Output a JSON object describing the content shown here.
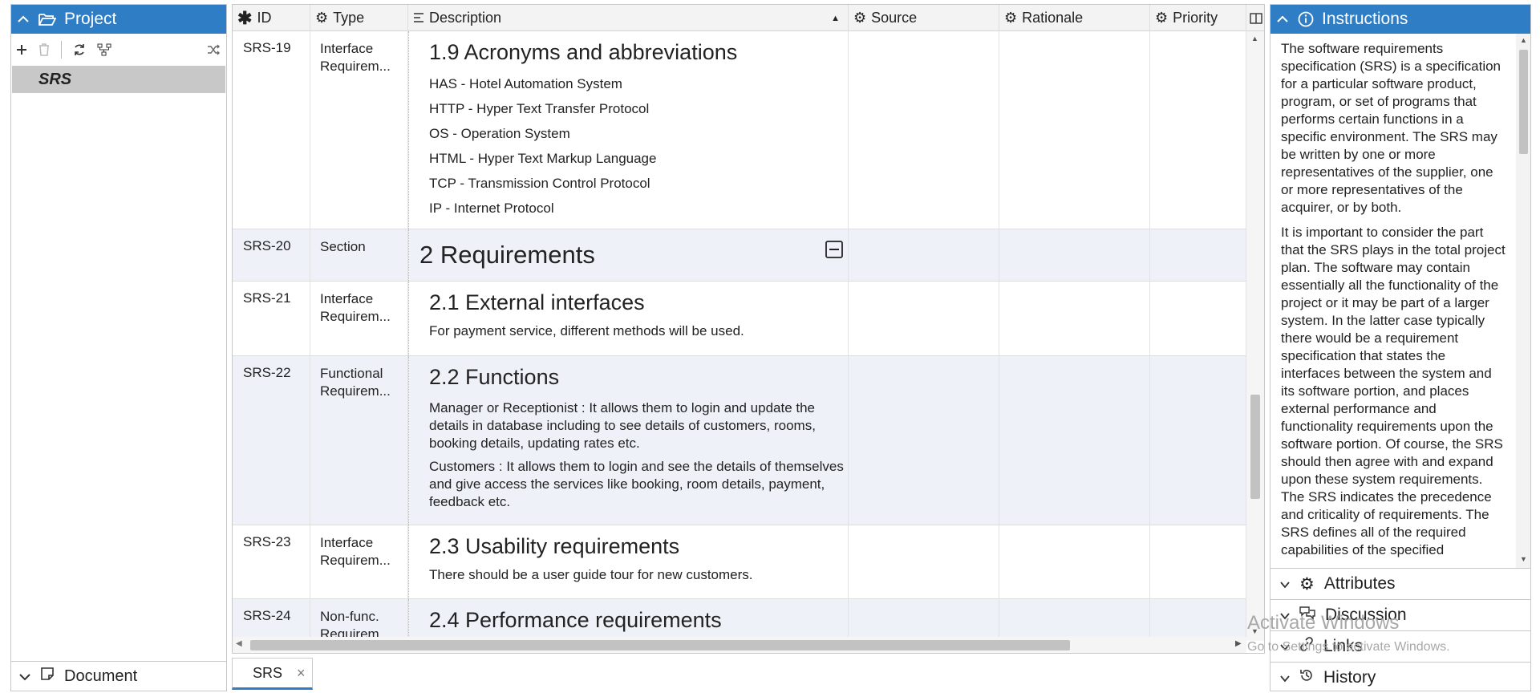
{
  "left_panel": {
    "title": "Project",
    "tree_item": "SRS",
    "bottom_section": "Document"
  },
  "grid": {
    "columns": [
      "ID",
      "Type",
      "Description",
      "Source",
      "Rationale",
      "Priority"
    ],
    "rows": [
      {
        "id": "SRS-19",
        "type": "Interface Requirem...",
        "heading": "1.9 Acronyms and abbreviations",
        "lines": [
          "HAS - Hotel Automation System",
          "HTTP - Hyper Text Transfer Protocol",
          "OS - Operation System",
          "HTML - Hyper Text Markup Language",
          "TCP - Transmission Control Protocol",
          "IP - Internet Protocol"
        ]
      },
      {
        "id": "SRS-20",
        "type": "Section",
        "heading": "2 Requirements"
      },
      {
        "id": "SRS-21",
        "type": "Interface Requirem...",
        "heading": "2.1 External interfaces",
        "paras": [
          "For payment service, different methods will be used."
        ]
      },
      {
        "id": "SRS-22",
        "type": "Functional Requirem...",
        "heading": "2.2 Functions",
        "paras": [
          "Manager or Receptionist : It allows them to login and update the details in database including to see details of customers, rooms, booking details, updating rates etc.",
          "Customers : It allows them to login and see the details of themselves and give access the services like booking, room details, payment, feedback etc."
        ]
      },
      {
        "id": "SRS-23",
        "type": "Interface Requirem...",
        "heading": "2.3 Usability requirements",
        "paras": [
          "There should be a user guide tour for new customers."
        ]
      },
      {
        "id": "SRS-24",
        "type": "Non-func. Requirem...",
        "heading": "2.4 Performance requirements"
      }
    ]
  },
  "tabs": [
    "SRS"
  ],
  "right_panel": {
    "title": "Instructions",
    "paragraphs": [
      "The software requirements specification (SRS) is a specification for a particular software product, program, or set of programs that performs certain functions in a specific environment. The SRS may be written by one or more representatives of the supplier, one or more representatives of the acquirer, or by both.",
      "It is important to consider the part that the SRS plays in the total project plan. The software may contain essentially all the functionality of the project or it may be part of a larger system. In the latter case typically there would be a requirement specification that states the interfaces between the system and its software portion, and places external performance and functionality requirements upon the software portion. Of course, the SRS should then agree with and expand upon these system requirements. The SRS indicates the precedence and criticality of requirements. The SRS defines all of the required capabilities of the specified"
    ],
    "sections": [
      "Attributes",
      "Discussion",
      "Links",
      "History"
    ]
  },
  "watermark": {
    "line1": "Activate Windows",
    "line2": "Go to Settings to activate Windows."
  },
  "colors": {
    "accent": "#2f7dc4",
    "alt_row": "#eef2f8"
  }
}
